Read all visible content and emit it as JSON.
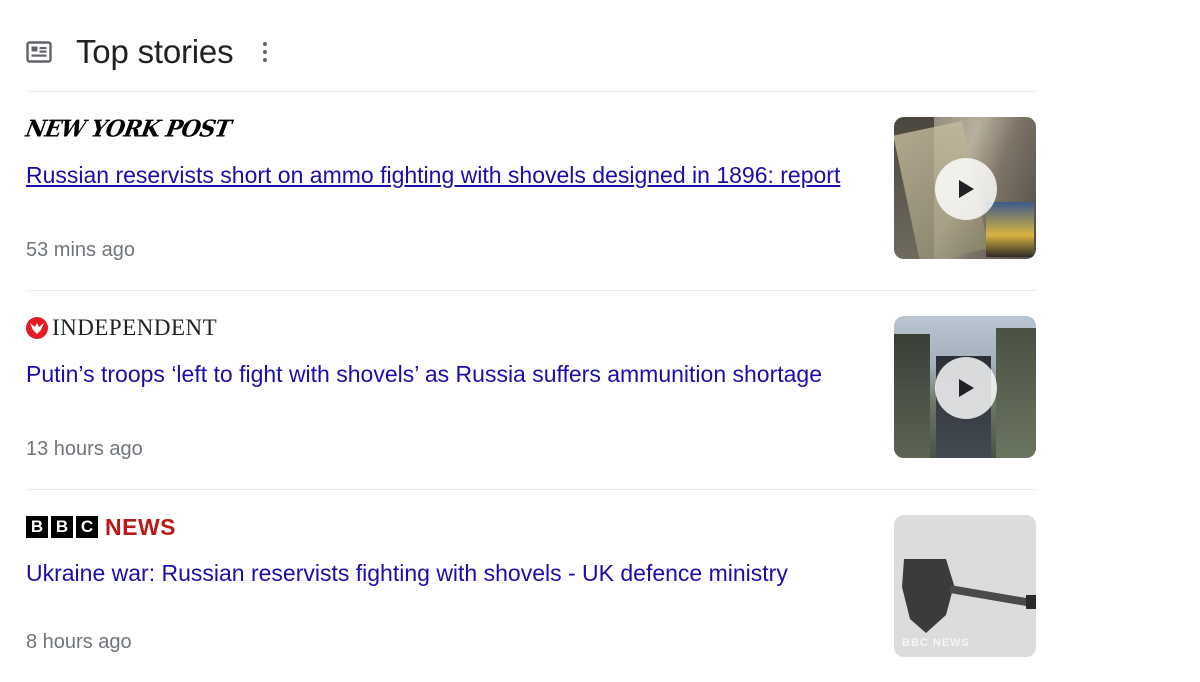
{
  "section": {
    "title": "Top stories",
    "icon": "news-icon",
    "menu_icon": "more-vert-icon"
  },
  "stories": [
    {
      "source": "NEW YORK POST",
      "headline": "Russian reservists short on ammo fighting with shovels designed in 1896: report",
      "time": "53 mins ago",
      "visited": true,
      "thumbnail": {
        "has_video": true,
        "icon": "play-icon"
      }
    },
    {
      "source": "INDEPENDENT",
      "headline": "Putin’s troops ‘left to fight with shovels’ as Russia suffers ammunition shortage",
      "time": "13 hours ago",
      "visited": false,
      "thumbnail": {
        "has_video": true,
        "icon": "play-icon"
      }
    },
    {
      "source_boxes": [
        "B",
        "B",
        "C"
      ],
      "source_word": "NEWS",
      "headline": "Ukraine war: Russian reservists fighting with shovels - UK defence ministry",
      "time": "8 hours ago",
      "visited": false,
      "thumbnail": {
        "has_video": false,
        "watermark": "BBC NEWS"
      }
    }
  ],
  "colors": {
    "link": "#1a0dab",
    "meta": "#70757a",
    "divider": "#e8eaed",
    "bbc_red": "#bb1919",
    "independent_red": "#e31b23"
  }
}
